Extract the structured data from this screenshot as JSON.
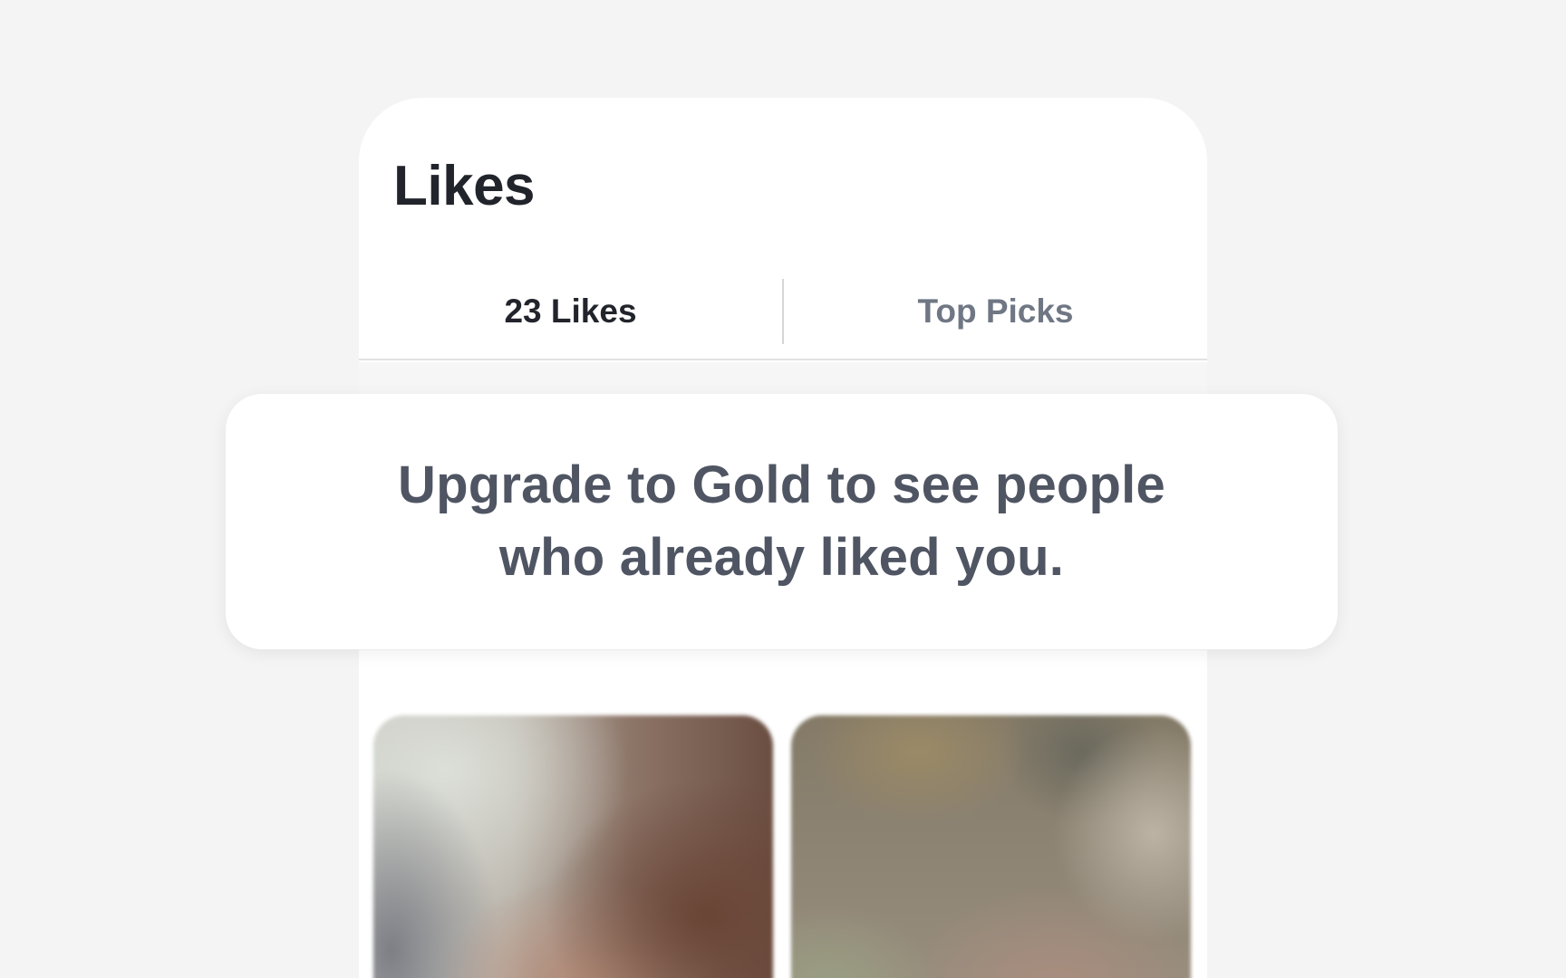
{
  "header": {
    "title": "Likes"
  },
  "tabs": [
    {
      "label": "23 Likes",
      "active": true
    },
    {
      "label": "Top Picks",
      "active": false
    }
  ],
  "upgrade_banner": {
    "text": "Upgrade to Gold to see people\nwho already liked you."
  },
  "colors": {
    "background": "#f4f4f4",
    "card": "#ffffff",
    "title_text": "#21242b",
    "inactive_tab_text": "#707784",
    "banner_text": "#4f5562"
  }
}
